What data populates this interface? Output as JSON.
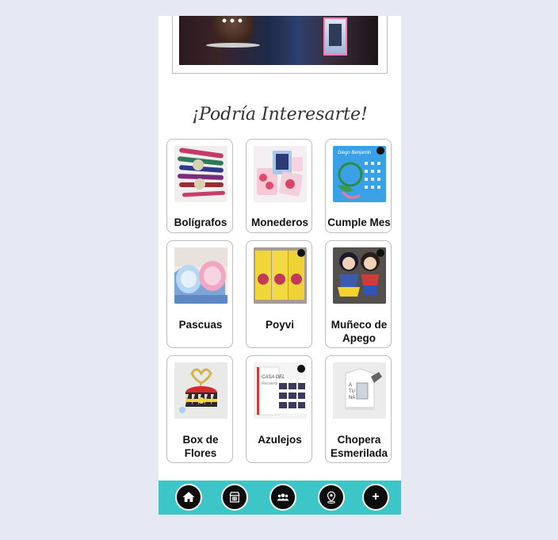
{
  "section": {
    "title": "¡Podría Interesarte!"
  },
  "products": [
    {
      "label": "Bolígrafos",
      "icon": "pens-image"
    },
    {
      "label": "Monederos",
      "icon": "purses-image"
    },
    {
      "label": "Cumple Mes",
      "icon": "birthday-board-image"
    },
    {
      "label": "Pascuas",
      "icon": "easter-eggs-image"
    },
    {
      "label": "Poyvi",
      "icon": "poyvi-image"
    },
    {
      "label": "Muñeco de Apego",
      "icon": "dolls-image"
    },
    {
      "label": "Box de Flores",
      "icon": "flower-box-image"
    },
    {
      "label": "Azulejos",
      "icon": "tiles-image"
    },
    {
      "label": "Chopera Esmerilada",
      "icon": "beer-mug-image"
    }
  ],
  "bottom_nav": {
    "background": "#3cc6c8",
    "items": [
      "home-icon",
      "store-icon",
      "group-icon",
      "location-icon",
      "plus-icon"
    ],
    "plus_label": "+"
  }
}
